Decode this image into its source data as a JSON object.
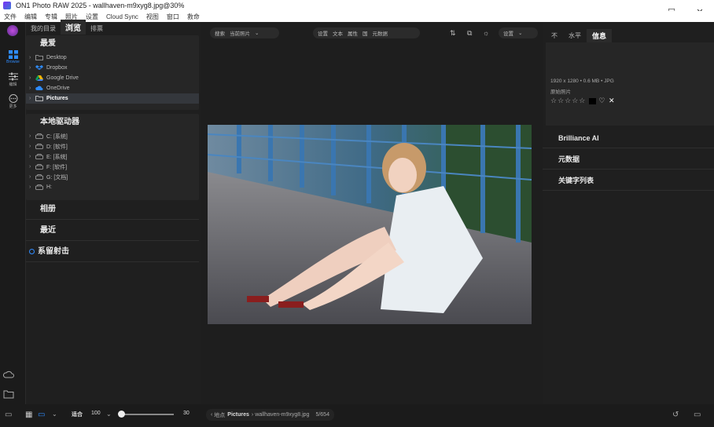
{
  "window": {
    "title": "ON1 Photo RAW 2025 - wallhaven-m9xyg8.jpg@30%",
    "minimize": "—",
    "maximize": "☐",
    "close": "✕"
  },
  "menu": [
    "文件",
    "编辑",
    "专辑",
    "照片",
    "设置",
    "Cloud Sync",
    "视图",
    "窗口",
    "救命"
  ],
  "rail": {
    "browse_label": "Browse",
    "edit_label": "编辑",
    "more_label": "更多"
  },
  "left_tabs": [
    "我的目录",
    "浏览",
    "排票"
  ],
  "favorites": {
    "title": "最爱",
    "items": [
      {
        "label": "Desktop",
        "icon": "folder-icon"
      },
      {
        "label": "Dropbox",
        "icon": "dropbox-icon"
      },
      {
        "label": "Google Drive",
        "icon": "google-drive-icon"
      },
      {
        "label": "OneDrive",
        "icon": "onedrive-icon"
      },
      {
        "label": "Pictures",
        "icon": "folder-icon",
        "selected": true
      }
    ]
  },
  "drives": {
    "title": "本地驱动器",
    "items": [
      "C: [系统]",
      "D: [软件]",
      "E: [系统]",
      "F: [软件]",
      "G: [文档]",
      "H:"
    ]
  },
  "albums_title": "相册",
  "recent_title": "最近",
  "tethered_title": "系留射击",
  "toolbar": {
    "search_label": "搜索",
    "search_scope": "当前照片",
    "filters": [
      "设置",
      "文本",
      "属性",
      "国",
      "元数据"
    ],
    "settings_label": "设置"
  },
  "right_tabs": [
    "不",
    "水平",
    "信息"
  ],
  "info": {
    "dimensions": "1920 x 1280 • 0.6 MB • JPG",
    "label": "原始照片",
    "stars": "☆☆☆☆☆"
  },
  "right_sections": [
    "Brilliance AI",
    "元数据",
    "关键字列表"
  ],
  "bottom": {
    "fit_label": "适合",
    "zoom_value": "100",
    "slider_value": "30",
    "crumb_prefix": "地点",
    "crumb_folder": "Pictures",
    "crumb_file": "wallhaven-m9xyg8.jpg",
    "crumb_count": "5/654"
  },
  "colors": {
    "accent": "#2f8cff",
    "panel": "#262626",
    "background": "#1e1e1e"
  }
}
